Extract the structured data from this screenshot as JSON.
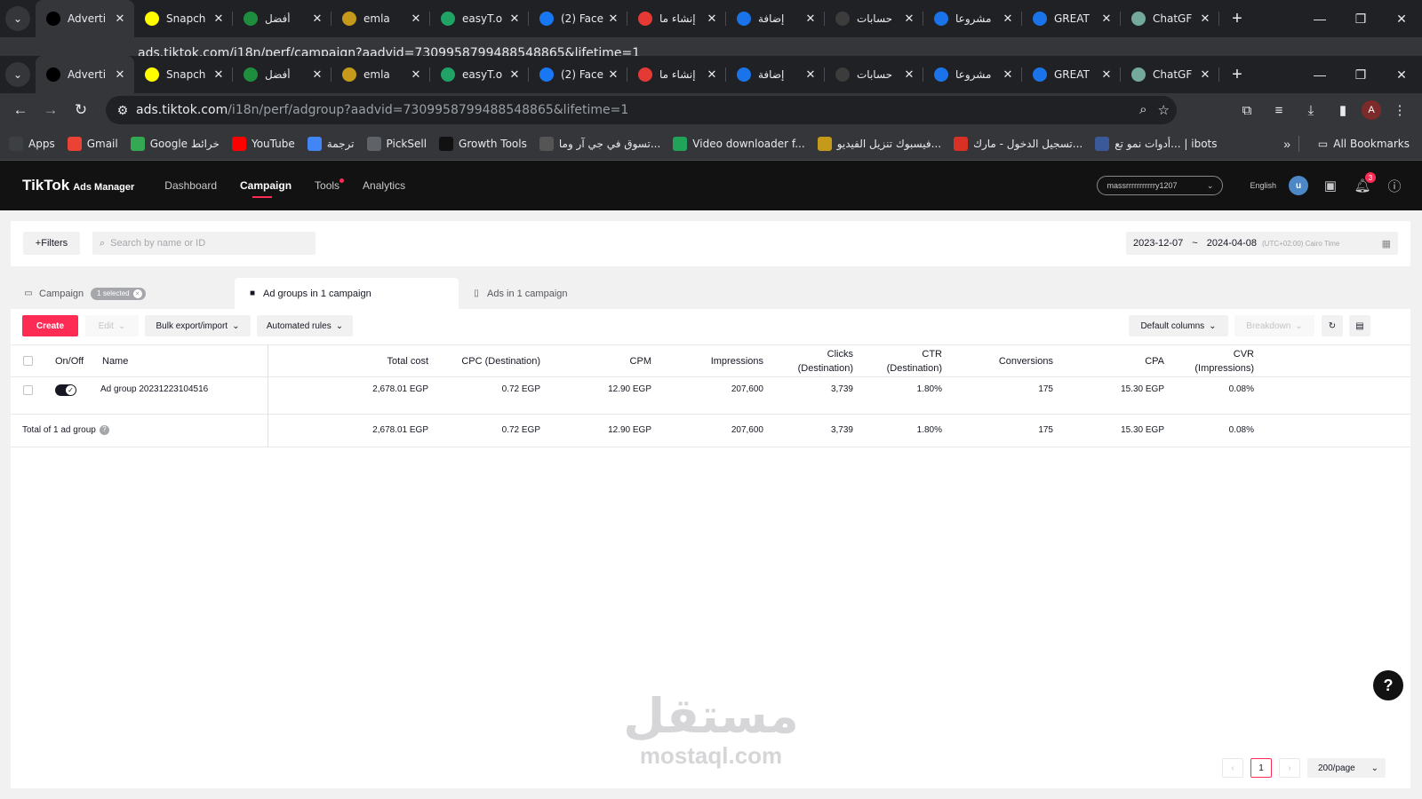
{
  "browser": {
    "tabs": [
      {
        "title": "Adverti",
        "icon": "tiktok-icon",
        "color": "#000000",
        "active": true
      },
      {
        "title": "Snapch",
        "icon": "snapchat-icon",
        "color": "#FFFC00"
      },
      {
        "title": "أفضل",
        "icon": "lock-icon",
        "color": "#1e8e3e"
      },
      {
        "title": "emla",
        "icon": "emla-icon",
        "color": "#c59a1a"
      },
      {
        "title": "easyT.o",
        "icon": "easyt-icon",
        "color": "#21a366"
      },
      {
        "title": "(2) Face",
        "icon": "facebook-icon",
        "color": "#1877f2"
      },
      {
        "title": "إنشاء ما",
        "icon": "e-icon",
        "color": "#e53935"
      },
      {
        "title": "إضافة",
        "icon": "circle-icon",
        "color": "#1a73e8"
      },
      {
        "title": "حسابات",
        "icon": "dark-icon",
        "color": "#3c3c3c"
      },
      {
        "title": "مشروعا",
        "icon": "c-icon",
        "color": "#1a73e8"
      },
      {
        "title": "GREAT",
        "icon": "c-icon",
        "color": "#1a73e8"
      },
      {
        "title": "ChatGF",
        "icon": "chatgpt-icon",
        "color": "#74aa9c"
      }
    ],
    "back_url": "ads.tiktok.com/i18n/perf/campaign?aadvid=7309958799488548865&lifetime=1",
    "url_domain": "ads.tiktok.com",
    "url_path": "/i18n/perf/adgroup?aadvid=7309958799488548865&lifetime=1",
    "profile_initial": "A",
    "bookmarks": [
      {
        "label": "Apps",
        "icon": "apps-icon"
      },
      {
        "label": "Gmail",
        "icon": "gmail-icon"
      },
      {
        "label": "Google خرائط",
        "icon": "maps-icon"
      },
      {
        "label": "YouTube",
        "icon": "youtube-icon"
      },
      {
        "label": "ترجمة",
        "icon": "translate-icon"
      },
      {
        "label": "PickSell",
        "icon": "picksell-icon"
      },
      {
        "label": "Growth Tools",
        "icon": "growth-icon"
      },
      {
        "label": "تسوق في جي آر وما...",
        "icon": "shop-icon"
      },
      {
        "label": "Video downloader f...",
        "icon": "download-icon"
      },
      {
        "label": "فيسبوك تنزيل الفيديو...",
        "icon": "fb-dl-icon"
      },
      {
        "label": "تسجيل الدخول - مارك...",
        "icon": "login-icon"
      },
      {
        "label": "أدوات نمو تع... | ibots",
        "icon": "ibots-icon"
      }
    ],
    "all_bookmarks": "All Bookmarks"
  },
  "header": {
    "logo": "TikTok",
    "logo_sub": "Ads Manager",
    "nav": [
      "Dashboard",
      "Campaign",
      "Tools",
      "Analytics"
    ],
    "account": "massrrrrrrrrrrry1207",
    "language": "English",
    "user_initial": "u",
    "notifications": "3"
  },
  "filters": {
    "filters_label": "Filters",
    "search_placeholder": "Search by name or ID",
    "date_from": "2023-12-07",
    "date_sep": "~",
    "date_to": "2024-04-08",
    "timezone": "(UTC+02:00) Cairo Time"
  },
  "level_tabs": {
    "campaign": "Campaign",
    "selected": "1 selected",
    "adgroups": "Ad groups in 1 campaign",
    "ads": "Ads in 1 campaign"
  },
  "toolbar": {
    "create": "Create",
    "edit": "Edit",
    "bulk": "Bulk export/import",
    "rules": "Automated rules",
    "columns": "Default columns",
    "breakdown": "Breakdown"
  },
  "table": {
    "headers": {
      "onoff": "On/Off",
      "name": "Name",
      "cost": "Total cost",
      "cpc": "CPC (Destination)",
      "cpm": "CPM",
      "impressions": "Impressions",
      "clicks": "Clicks (Destination)",
      "ctr": "CTR (Destination)",
      "conversions": "Conversions",
      "cpa": "CPA",
      "cvr": "CVR (Impressions)"
    },
    "row": {
      "name": "Ad group 20231223104516",
      "cost": "2,678.01 EGP",
      "cpc": "0.72 EGP",
      "cpm": "12.90 EGP",
      "impressions": "207,600",
      "clicks": "3,739",
      "ctr": "1.80%",
      "conversions": "175",
      "cpa": "15.30 EGP",
      "cvr": "0.08%"
    },
    "total": {
      "label": "Total of 1 ad group",
      "cost": "2,678.01 EGP",
      "cpc": "0.72 EGP",
      "cpm": "12.90 EGP",
      "impressions": "207,600",
      "clicks": "3,739",
      "ctr": "1.80%",
      "conversions": "175",
      "cpa": "15.30 EGP",
      "cvr": "0.08%"
    }
  },
  "pagination": {
    "page": "1",
    "page_size": "200/page"
  },
  "watermark": {
    "arabic": "مستقل",
    "latin": "mostaql.com"
  },
  "colors": {
    "accent": "#fe2c55",
    "header_bg": "#121212"
  }
}
